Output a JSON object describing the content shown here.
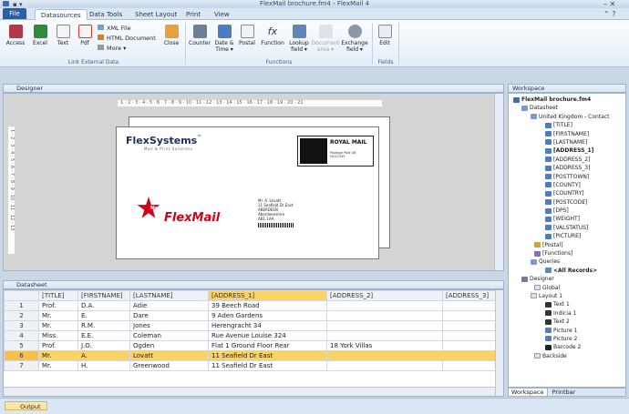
{
  "window": {
    "title": "FlexMail brochure.fm4 - FlexMail 4"
  },
  "tabs": [
    {
      "label": "File"
    },
    {
      "label": "Datasources"
    },
    {
      "label": "Data Tools"
    },
    {
      "label": "Sheet Layout"
    },
    {
      "label": "Print"
    },
    {
      "label": "View"
    }
  ],
  "ribbon": {
    "access": "Access",
    "excel": "Excel",
    "text": "Text",
    "pdf": "Pdf",
    "xml_file": "XML File",
    "html_document": "HTML Document",
    "more": "More ▾",
    "close": "Close",
    "group_link": "Link External Data",
    "counter": "Counter",
    "date_time": "Date &",
    "date_time2": "Time ▾",
    "postal": "Postal",
    "function": "Function",
    "lookup": "Lookup",
    "lookup2": "field ▾",
    "document_area": "Document",
    "document_area2": "area ▾",
    "exchange": "Exchange",
    "exchange2": "field ▾",
    "group_functions": "Functions",
    "edit": "Edit",
    "group_fields": "Fields"
  },
  "designer": {
    "tab_label": "Designer",
    "ruler": "· 1 · 2 · 3 · 4 · 5 · 6 · 7 · 8 · 9 · 10 · 11 · 12 · 13 · 14 · 15 · 16 · 17 · 18 · 19 · 20 · 21",
    "ruler_v": "· 1 · 2 · 3 · 4 · 5 · 6 · 7 · 8 · 9 · 10 · 11 · 12 · 13",
    "brand": "FlexSystems",
    "brand_tm": "™",
    "brand_sub": "Mail & Print Solutions",
    "royal_mail": "ROYAL MAIL",
    "royal_small": "Postage Paid GB\nHQ12345",
    "flexmail_logo": "FlexMail",
    "logo_tag": "Now!",
    "address_lines": [
      "Mr. A. Lovatt",
      "11 Seafield Dr East",
      "ABERDEEN",
      "Aberdeenshire",
      "AB1 1AA"
    ]
  },
  "datasheet": {
    "tab_label": "Datasheet",
    "columns": [
      "[TITLE]",
      "[FIRSTNAME]",
      "[LASTNAME]",
      "[ADDRESS_1]",
      "[ADDRESS_2]",
      "[ADDRESS_3]"
    ],
    "rows": [
      [
        "1",
        "Prof.",
        "D.A.",
        "Adie",
        "39 Beech Road",
        "",
        ""
      ],
      [
        "2",
        "Mr.",
        "E.",
        "Dare",
        "9 Aden Gardens",
        "",
        ""
      ],
      [
        "3",
        "Mr.",
        "R.M.",
        "Jones",
        "Herengracht 34",
        "",
        ""
      ],
      [
        "4",
        "Miss.",
        "E.E.",
        "Coleman",
        "Rue Avenue Louise 324",
        "",
        ""
      ],
      [
        "5",
        "Prof.",
        "J.O.",
        "Ogden",
        "Flat 1 Ground Floor Rear",
        "18 York Villas",
        ""
      ],
      [
        "6",
        "Mr.",
        "A.",
        "Lovatt",
        "11 Seafield Dr East",
        "",
        ""
      ],
      [
        "7",
        "Mr.",
        "H.",
        "Greenwood",
        "11 Seafield Dr East",
        "",
        ""
      ]
    ],
    "selected_row": "6"
  },
  "workspace": {
    "title": "Workspace",
    "tree": [
      {
        "label": "FlexMail brochure.fm4",
        "bold": true
      },
      {
        "label": "Datasheet"
      },
      {
        "label": "United Kingdom - Contact"
      },
      {
        "label": "[TITLE]"
      },
      {
        "label": "[FIRSTNAME]"
      },
      {
        "label": "[LASTNAME]"
      },
      {
        "label": "[ADDRESS_1]",
        "bold": true
      },
      {
        "label": "[ADDRESS_2]"
      },
      {
        "label": "[ADDRESS_3]"
      },
      {
        "label": "[POSTTOWN]"
      },
      {
        "label": "[COUNTY]"
      },
      {
        "label": "[COUNTRY]"
      },
      {
        "label": "[POSTCODE]"
      },
      {
        "label": "[DPS]"
      },
      {
        "label": "[WEIGHT]"
      },
      {
        "label": "[VALSTATUS]"
      },
      {
        "label": "[PICTURE]"
      },
      {
        "label": "[Postal]"
      },
      {
        "label": "[Functions]"
      },
      {
        "label": "Queries"
      },
      {
        "label": "<All Records>",
        "bold": true
      },
      {
        "label": "Designer"
      },
      {
        "label": "Global"
      },
      {
        "label": "Layout 1"
      },
      {
        "label": "Text 1"
      },
      {
        "label": "Indicia 1"
      },
      {
        "label": "Text 2"
      },
      {
        "label": "Picture 1"
      },
      {
        "label": "Picture 2"
      },
      {
        "label": "Barcode 2"
      },
      {
        "label": "Backside"
      }
    ],
    "bottom_tabs": [
      "Workspace",
      "Printbar"
    ]
  },
  "status": {
    "output": "Output"
  },
  "colors": {
    "accent": "#2a5fa8",
    "selection": "#fbd363",
    "brand_red": "#d0021b"
  }
}
